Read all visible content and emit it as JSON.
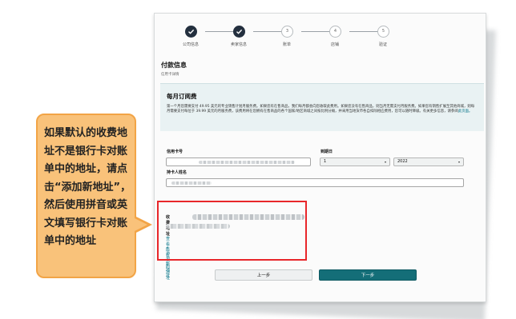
{
  "stepper": [
    {
      "label": "公司信息",
      "state": "done",
      "number": ""
    },
    {
      "label": "卖家信息",
      "state": "done",
      "number": ""
    },
    {
      "label": "账单",
      "state": "todo",
      "number": "3"
    },
    {
      "label": "店铺",
      "state": "todo",
      "number": "4"
    },
    {
      "label": "验证",
      "state": "todo",
      "number": "5"
    }
  ],
  "payment": {
    "title": "付款信息",
    "subtitle": "信用卡详情"
  },
  "subscription": {
    "title": "每月订阅费",
    "text": "第一个月您需要支付 49.95 美元的专业销售计划月服务费。如果您有在售商品，我们每月都会向您收取此费用。如果您没有在售商品，则当月无需支付月服务费。如果您有销售扩展至其他商城，则每月需要支付每位于 39.99 美元的月服务费，该费用将在您拥有在售商品的各个国家/地区商城之间按比例分摊，并采用当地货币各自扣除相应费用，您可以随时降级。有关更多信息，请参阅",
    "link": "此页面。"
  },
  "form": {
    "card_number_label": "信用卡号",
    "expiry_label": "到期日",
    "month_value": "1",
    "year_value": "2022",
    "holder_label": "持卡人姓名"
  },
  "billing": {
    "label": "收费地址",
    "view_all": "查看所有您的地址",
    "add_new": "+ 添加新地址"
  },
  "buttons": {
    "prev": "上一步",
    "next": "下一步"
  },
  "callout": {
    "text": "如果默认的收费地址不是银行卡对账单中的地址，请点击“添加新地址”，然后使用拼音或英文填写银行卡对账单中的地址"
  },
  "colors": {
    "accent": "#146e78",
    "highlight": "#e8262a",
    "callout_fill": "#f9c27a"
  }
}
